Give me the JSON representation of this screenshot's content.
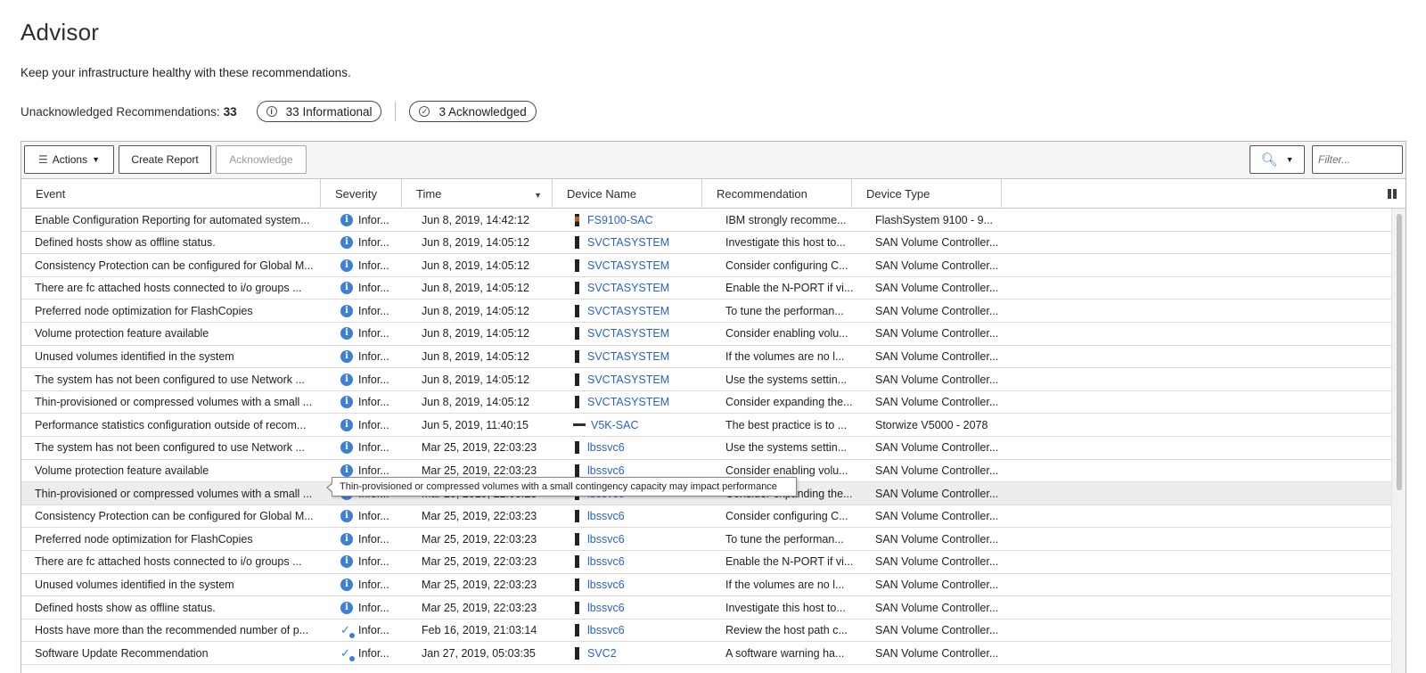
{
  "page": {
    "title": "Advisor",
    "subtitle": "Keep your infrastructure healthy with these recommendations.",
    "unack_label": "Unacknowledged Recommendations:",
    "unack_count": "33",
    "informational_pill": "33 Informational",
    "acknowledged_pill": "3 Acknowledged"
  },
  "toolbar": {
    "actions_label": "Actions",
    "create_report_label": "Create Report",
    "acknowledge_label": "Acknowledge",
    "filter_placeholder": "Filter..."
  },
  "columns": {
    "event": "Event",
    "severity": "Severity",
    "time": "Time",
    "device_name": "Device Name",
    "recommendation": "Recommendation",
    "device_type": "Device Type"
  },
  "sort": {
    "column": "Time",
    "direction": "descending"
  },
  "colors": {
    "link": "#2a63c4",
    "info_icon": "#3c7fd4",
    "row_highlight": "#ededed"
  },
  "tooltip": "Thin-provisioned or compressed volumes with a small contingency capacity may impact performance",
  "rows": [
    {
      "event": "Enable Configuration Reporting for automated system...",
      "sev_icon": "info-icon",
      "severity": "Infor...",
      "time": "Jun 8, 2019, 14:42:12",
      "dev_icon": "flashsystem-icon",
      "device": "FS9100-SAC",
      "rec": "IBM strongly recomme...",
      "type": "FlashSystem 9100 - 9..."
    },
    {
      "event": "Defined hosts show as offline status.",
      "sev_icon": "info-icon",
      "severity": "Infor...",
      "time": "Jun 8, 2019, 14:05:12",
      "dev_icon": "svc-icon",
      "device": "SVCTASYSTEM",
      "rec": "Investigate this host to...",
      "type": "SAN Volume Controller..."
    },
    {
      "event": "Consistency Protection can be configured for Global M...",
      "sev_icon": "info-icon",
      "severity": "Infor...",
      "time": "Jun 8, 2019, 14:05:12",
      "dev_icon": "svc-icon",
      "device": "SVCTASYSTEM",
      "rec": "Consider configuring C...",
      "type": "SAN Volume Controller..."
    },
    {
      "event": "There are fc attached hosts connected to i/o groups ...",
      "sev_icon": "info-icon",
      "severity": "Infor...",
      "time": "Jun 8, 2019, 14:05:12",
      "dev_icon": "svc-icon",
      "device": "SVCTASYSTEM",
      "rec": "Enable the N-PORT if vi...",
      "type": "SAN Volume Controller..."
    },
    {
      "event": "Preferred node optimization for FlashCopies",
      "sev_icon": "info-icon",
      "severity": "Infor...",
      "time": "Jun 8, 2019, 14:05:12",
      "dev_icon": "svc-icon",
      "device": "SVCTASYSTEM",
      "rec": "To tune the performan...",
      "type": "SAN Volume Controller..."
    },
    {
      "event": "Volume protection feature available",
      "sev_icon": "info-icon",
      "severity": "Infor...",
      "time": "Jun 8, 2019, 14:05:12",
      "dev_icon": "svc-icon",
      "device": "SVCTASYSTEM",
      "rec": "Consider enabling volu...",
      "type": "SAN Volume Controller..."
    },
    {
      "event": "Unused volumes identified in the system",
      "sev_icon": "info-icon",
      "severity": "Infor...",
      "time": "Jun 8, 2019, 14:05:12",
      "dev_icon": "svc-icon",
      "device": "SVCTASYSTEM",
      "rec": "If the volumes are no l...",
      "type": "SAN Volume Controller..."
    },
    {
      "event": "The system has not been configured to use Network ...",
      "sev_icon": "info-icon",
      "severity": "Infor...",
      "time": "Jun 8, 2019, 14:05:12",
      "dev_icon": "svc-icon",
      "device": "SVCTASYSTEM",
      "rec": "Use the systems settin...",
      "type": "SAN Volume Controller..."
    },
    {
      "event": "Thin-provisioned or compressed volumes with a small ...",
      "sev_icon": "info-icon",
      "severity": "Infor...",
      "time": "Jun 8, 2019, 14:05:12",
      "dev_icon": "svc-icon",
      "device": "SVCTASYSTEM",
      "rec": "Consider expanding the...",
      "type": "SAN Volume Controller..."
    },
    {
      "event": "Performance statistics configuration outside of recom...",
      "sev_icon": "info-icon",
      "severity": "Infor...",
      "time": "Jun 5, 2019, 11:40:15",
      "dev_icon": "storwize-icon",
      "device": "V5K-SAC",
      "rec": "The best practice is to ...",
      "type": "Storwize V5000 - 2078"
    },
    {
      "event": "The system has not been configured to use Network ...",
      "sev_icon": "info-icon",
      "severity": "Infor...",
      "time": "Mar 25, 2019, 22:03:23",
      "dev_icon": "svc-icon",
      "device": "lbssvc6",
      "rec": "Use the systems settin...",
      "type": "SAN Volume Controller..."
    },
    {
      "event": "Volume protection feature available",
      "sev_icon": "info-icon",
      "severity": "Infor...",
      "time": "Mar 25, 2019, 22:03:23",
      "dev_icon": "svc-icon",
      "device": "lbssvc6",
      "rec": "Consider enabling volu...",
      "type": "SAN Volume Controller..."
    },
    {
      "event": "Thin-provisioned or compressed volumes with a small ...",
      "sev_icon": "info-icon",
      "severity": "Infor...",
      "time": "Mar 25, 2019, 22:03:23",
      "dev_icon": "svc-icon",
      "device": "lbssvc6",
      "rec": "Consider expanding the...",
      "type": "SAN Volume Controller..."
    },
    {
      "event": "Consistency Protection can be configured for Global M...",
      "sev_icon": "info-icon",
      "severity": "Infor...",
      "time": "Mar 25, 2019, 22:03:23",
      "dev_icon": "svc-icon",
      "device": "lbssvc6",
      "rec": "Consider configuring C...",
      "type": "SAN Volume Controller..."
    },
    {
      "event": "Preferred node optimization for FlashCopies",
      "sev_icon": "info-icon",
      "severity": "Infor...",
      "time": "Mar 25, 2019, 22:03:23",
      "dev_icon": "svc-icon",
      "device": "lbssvc6",
      "rec": "To tune the performan...",
      "type": "SAN Volume Controller..."
    },
    {
      "event": "There are fc attached hosts connected to i/o groups ...",
      "sev_icon": "info-icon",
      "severity": "Infor...",
      "time": "Mar 25, 2019, 22:03:23",
      "dev_icon": "svc-icon",
      "device": "lbssvc6",
      "rec": "Enable the N-PORT if vi...",
      "type": "SAN Volume Controller..."
    },
    {
      "event": "Unused volumes identified in the system",
      "sev_icon": "info-icon",
      "severity": "Infor...",
      "time": "Mar 25, 2019, 22:03:23",
      "dev_icon": "svc-icon",
      "device": "lbssvc6",
      "rec": "If the volumes are no l...",
      "type": "SAN Volume Controller..."
    },
    {
      "event": "Defined hosts show as offline status.",
      "sev_icon": "info-icon",
      "severity": "Infor...",
      "time": "Mar 25, 2019, 22:03:23",
      "dev_icon": "svc-icon",
      "device": "lbssvc6",
      "rec": "Investigate this host to...",
      "type": "SAN Volume Controller..."
    },
    {
      "event": "Hosts have more than the recommended number of p...",
      "sev_icon": "update-icon",
      "severity": "Infor...",
      "time": "Feb 16, 2019, 21:03:14",
      "dev_icon": "svc-icon",
      "device": "lbssvc6",
      "rec": "Review the host path c...",
      "type": "SAN Volume Controller..."
    },
    {
      "event": "Software Update Recommendation",
      "sev_icon": "update-icon",
      "severity": "Infor...",
      "time": "Jan 27, 2019, 05:03:35",
      "dev_icon": "svc-icon",
      "device": "SVC2",
      "rec": "A software warning ha...",
      "type": "SAN Volume Controller..."
    }
  ]
}
